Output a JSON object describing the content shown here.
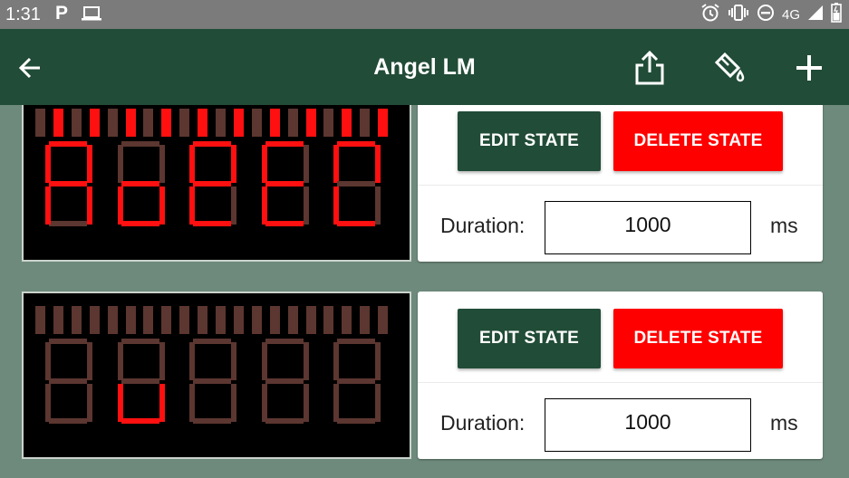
{
  "status_bar": {
    "time": "1:31",
    "notification_letter": "P",
    "network": "4G"
  },
  "app_bar": {
    "title": "Angel LM",
    "icons": [
      "arrow-back-icon",
      "share-icon",
      "paint-bucket-icon",
      "add-icon"
    ]
  },
  "colors": {
    "primary": "#214c37",
    "danger": "#ff0000",
    "segment_on": "#ff1010",
    "segment_off": "#5c3630",
    "background": "#6e8a7c"
  },
  "states": [
    {
      "leds": [
        0,
        1,
        0,
        1,
        0,
        1,
        0,
        1,
        0,
        1,
        0,
        1,
        0,
        1,
        0,
        1,
        0,
        1,
        0,
        1
      ],
      "digits": [
        {
          "a": 1,
          "b": 1,
          "c": 1,
          "d": 0,
          "e": 1,
          "f": 1,
          "g": 1
        },
        {
          "a": 0,
          "b": 0,
          "c": 1,
          "d": 1,
          "e": 1,
          "f": 0,
          "g": 1
        },
        {
          "a": 1,
          "b": 1,
          "c": 0,
          "d": 1,
          "e": 1,
          "f": 1,
          "g": 1
        },
        {
          "a": 1,
          "b": 0,
          "c": 0,
          "d": 1,
          "e": 1,
          "f": 1,
          "g": 1
        },
        {
          "a": 1,
          "b": 1,
          "c": 0,
          "d": 1,
          "e": 1,
          "f": 1,
          "g": 0
        }
      ],
      "edit_label": "EDIT STATE",
      "delete_label": "DELETE STATE",
      "duration_label": "Duration:",
      "duration_value": "1000",
      "duration_unit": "ms"
    },
    {
      "leds": [
        0,
        0,
        0,
        0,
        0,
        0,
        0,
        0,
        0,
        0,
        0,
        0,
        0,
        0,
        0,
        0,
        0,
        0,
        0,
        0
      ],
      "digits": [
        {
          "a": 0,
          "b": 0,
          "c": 0,
          "d": 0,
          "e": 0,
          "f": 0,
          "g": 0
        },
        {
          "a": 0,
          "b": 0,
          "c": 1,
          "d": 1,
          "e": 1,
          "f": 0,
          "g": 0
        },
        {
          "a": 0,
          "b": 0,
          "c": 0,
          "d": 0,
          "e": 0,
          "f": 0,
          "g": 0
        },
        {
          "a": 0,
          "b": 0,
          "c": 0,
          "d": 0,
          "e": 0,
          "f": 0,
          "g": 0
        },
        {
          "a": 0,
          "b": 0,
          "c": 0,
          "d": 0,
          "e": 0,
          "f": 0,
          "g": 0
        }
      ],
      "edit_label": "EDIT STATE",
      "delete_label": "DELETE STATE",
      "duration_label": "Duration:",
      "duration_value": "1000",
      "duration_unit": "ms"
    }
  ]
}
